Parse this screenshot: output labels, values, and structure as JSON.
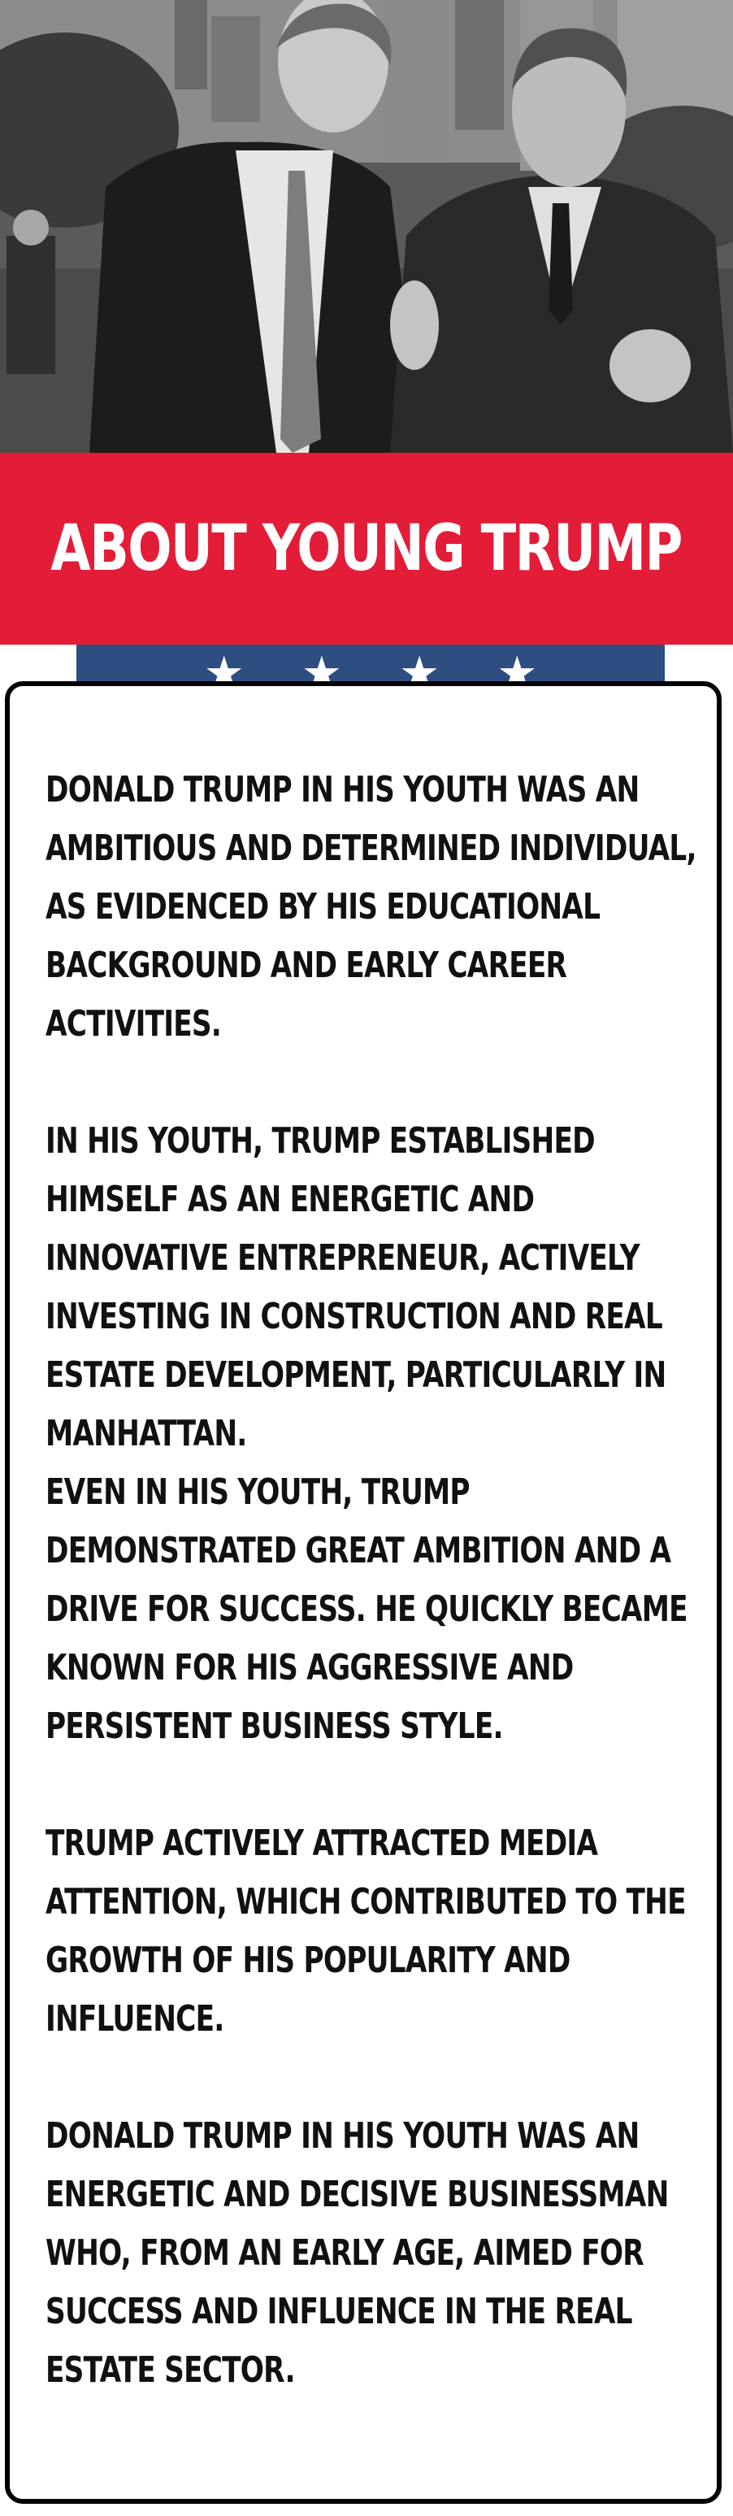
{
  "banner": {
    "title": "ABOUT YOUNG TRUMP"
  },
  "stars": [
    "★",
    "★",
    "★",
    "★"
  ],
  "paragraphs": [
    "DONALD TRUMP IN HIS YOUTH WAS AN AMBITIOUS AND DETERMINED INDIVIDUAL, AS EVIDENCED BY HIS EDUCATIONAL BACKGROUND AND EARLY CAREER ACTIVITIES.",
    "IN HIS YOUTH, TRUMP ESTABLISHED HIMSELF AS AN ENERGETIC AND INNOVATIVE ENTREPRENEUR, ACTIVELY INVESTING IN CONSTRUCTION AND REAL ESTATE DEVELOPMENT, PARTICULARLY IN MANHATTAN.",
    "EVEN IN HIS YOUTH, TRUMP DEMONSTRATED GREAT AMBITION AND A DRIVE FOR SUCCESS. HE QUICKLY BECAME KNOWN FOR HIS AGGRESSIVE AND PERSISTENT BUSINESS STYLE.",
    "TRUMP ACTIVELY ATTRACTED MEDIA ATTENTION, WHICH CONTRIBUTED TO THE GROWTH OF HIS POPULARITY AND INFLUENCE.",
    "DONALD TRUMP IN HIS YOUTH WAS AN ENERGETIC AND DECISIVE BUSINESSMAN WHO, FROM AN EARLY AGE, AIMED FOR SUCCESS AND INFLUENCE IN THE REAL ESTATE SECTOR."
  ],
  "colors": {
    "banner_red": "#e31c37",
    "stars_blue": "#2e4d80",
    "text": "#111111"
  }
}
